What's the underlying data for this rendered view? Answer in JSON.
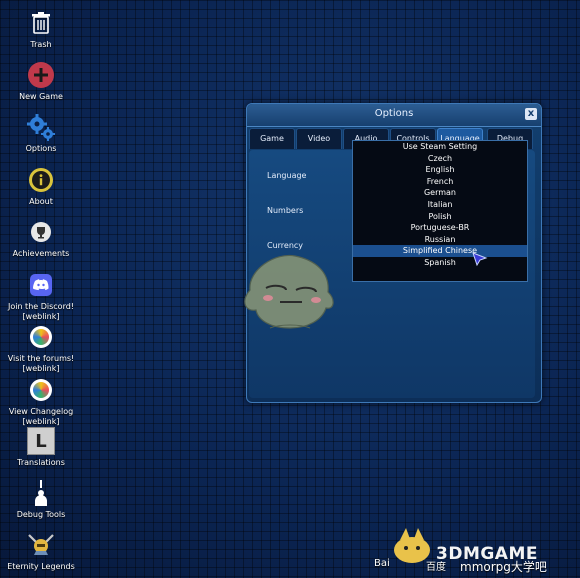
{
  "desktop": {
    "icons": [
      {
        "label": "Trash",
        "icon": "trash-icon"
      },
      {
        "label": "New Game",
        "icon": "plus-circle-icon"
      },
      {
        "label": "Options",
        "icon": "gears-icon"
      },
      {
        "label": "About",
        "icon": "info-icon"
      },
      {
        "label": "Achievements",
        "icon": "trophy-icon"
      },
      {
        "label": "Join the Discord!",
        "sub": "[weblink]",
        "icon": "discord-icon"
      },
      {
        "label": "Visit the forums!",
        "sub": "[weblink]",
        "icon": "chat-bubble-icon"
      },
      {
        "label": "View Changelog",
        "sub": "[weblink]",
        "icon": "chat-bubble-icon"
      },
      {
        "label": "Translations",
        "icon": "letter-l-icon"
      },
      {
        "label": "Debug Tools",
        "icon": "debug-figure-icon"
      },
      {
        "label": "Eternity Legends",
        "icon": "knight-icon"
      }
    ]
  },
  "window": {
    "title": "Options",
    "close_label": "x",
    "tabs": [
      {
        "label": "Game"
      },
      {
        "label": "Video"
      },
      {
        "label": "Audio"
      },
      {
        "label": "Controls"
      },
      {
        "label": "Language",
        "active": true
      },
      {
        "label": "Debug"
      }
    ],
    "rows": [
      {
        "label": "Language"
      },
      {
        "label": "Numbers"
      },
      {
        "label": "Currency"
      }
    ]
  },
  "dropdown": {
    "options": [
      "Use Steam Setting",
      "Czech",
      "English",
      "French",
      "German",
      "Italian",
      "Polish",
      "Portuguese-BR",
      "Russian",
      "Simplified Chinese",
      "Spanish"
    ],
    "hovered": "Simplified Chinese"
  },
  "watermark": {
    "baidu": "Bai",
    "baidu_suffix": "百度",
    "site": "3DMGAME",
    "forum": "mmorpg大学吧"
  },
  "colors": {
    "background": "#0b1f44",
    "window": "#123f6f",
    "accent": "#1d5aa0",
    "new_game_red": "#c0394b",
    "options_blue": "#2f7ed8"
  }
}
